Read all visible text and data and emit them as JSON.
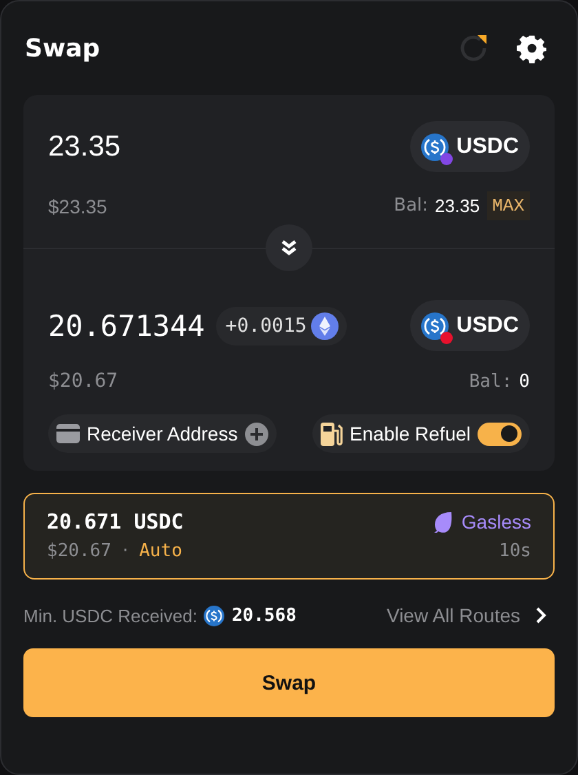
{
  "title": "Swap",
  "from": {
    "amount": "23.35",
    "token": {
      "symbol": "USDC",
      "color": "#8247e5"
    },
    "usd": "$23.35",
    "balance_label": "Bal:",
    "balance": "23.35",
    "max": "MAX"
  },
  "to": {
    "amount": "20.671344",
    "bonus": "+0.0015",
    "token": {
      "symbol": "USDC",
      "color": "#e8112d"
    },
    "usd": "$20.67",
    "balance_label": "Bal:",
    "balance": "0"
  },
  "receiver": {
    "label": "Receiver Address"
  },
  "refuel": {
    "label": "Enable Refuel",
    "on": true
  },
  "route": {
    "amount": "20.671 USDC",
    "usd": "$20.67",
    "separator": "·",
    "mode": "Auto",
    "tag": "Gasless",
    "time": "10s",
    "selected": true
  },
  "min_received": {
    "label": "Min. USDC Received:",
    "value": "20.568"
  },
  "view_routes": "View All Routes",
  "button": "Swap"
}
